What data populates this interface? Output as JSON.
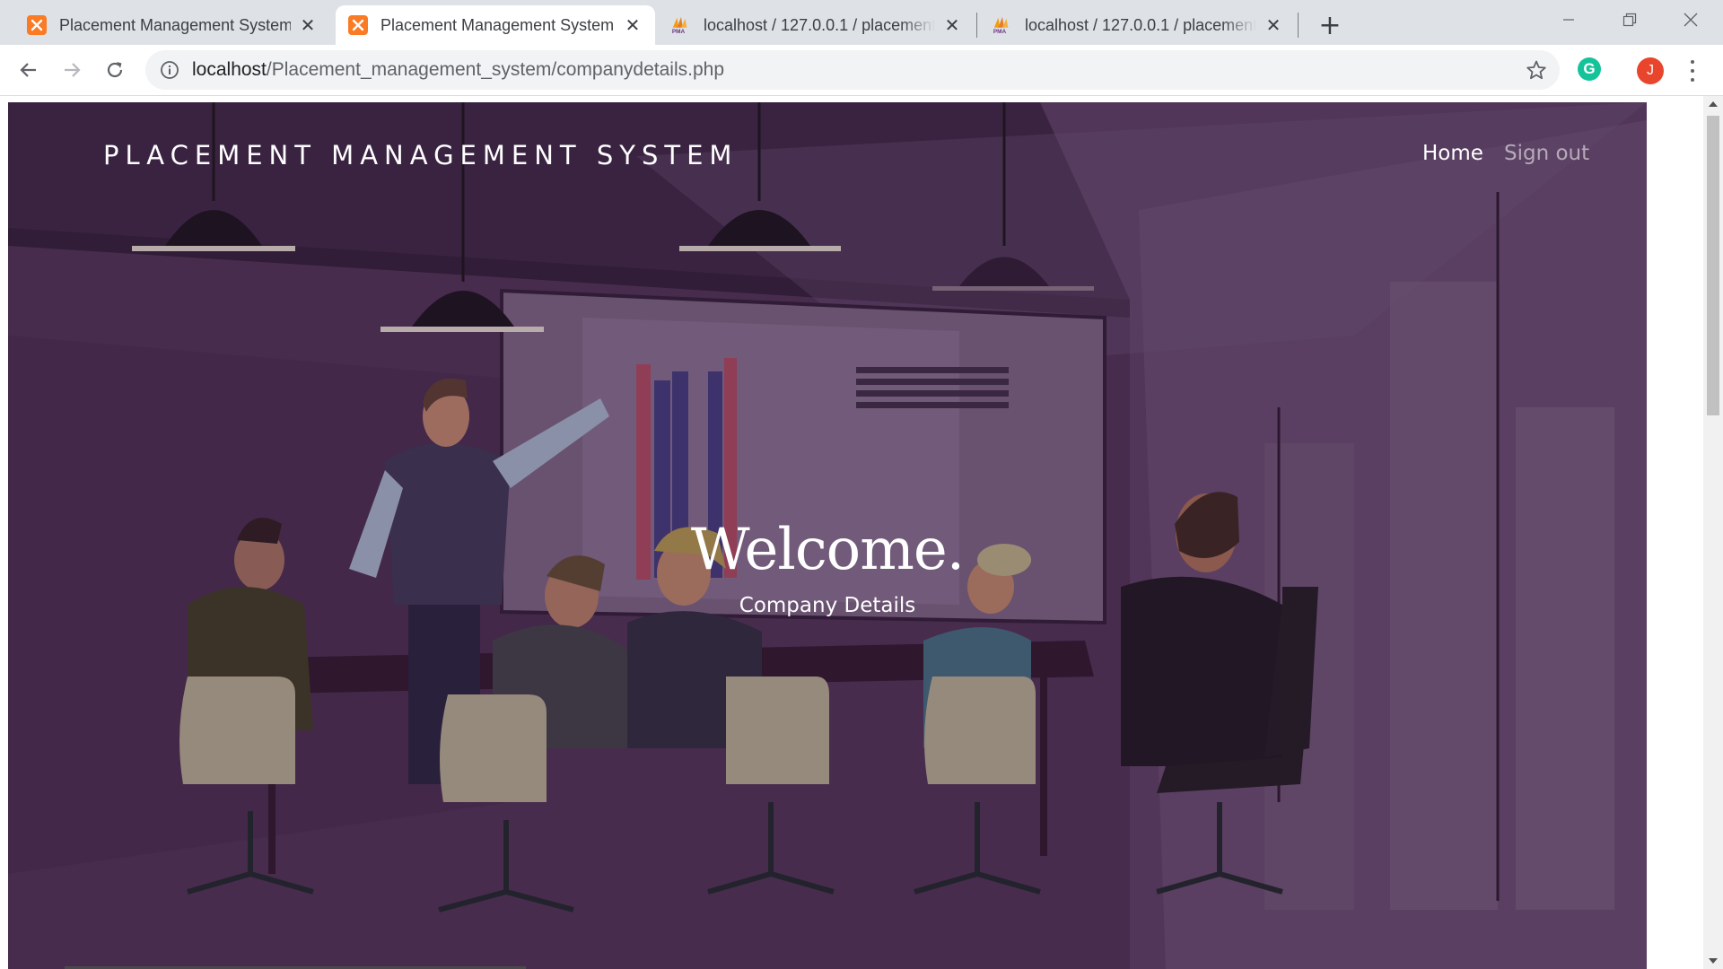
{
  "browser": {
    "tabs": [
      {
        "title": "Placement Management System",
        "icon": "xampp-icon",
        "active": false
      },
      {
        "title": "Placement Management System",
        "icon": "xampp-icon",
        "active": true
      },
      {
        "title": "localhost / 127.0.0.1 / placement",
        "icon": "phpmyadmin-icon",
        "active": false
      },
      {
        "title": "localhost / 127.0.0.1 / placement",
        "icon": "phpmyadmin-icon",
        "active": false
      }
    ],
    "url_host": "localhost",
    "url_path": "/Placement_management_system/companydetails.php",
    "profile_initial": "J",
    "extension_initial": "G",
    "colors": {
      "profile": "#e8452c",
      "grammarly": "#15c39a",
      "xampp": "#fb7a24"
    }
  },
  "site": {
    "brand": "PLACEMENT MANAGEMENT SYSTEM",
    "nav": {
      "home": "Home",
      "signout": "Sign out"
    },
    "hero": {
      "heading": "Welcome.",
      "subheading": "Company Details"
    },
    "background_illustration": "office-meeting-illustration"
  }
}
